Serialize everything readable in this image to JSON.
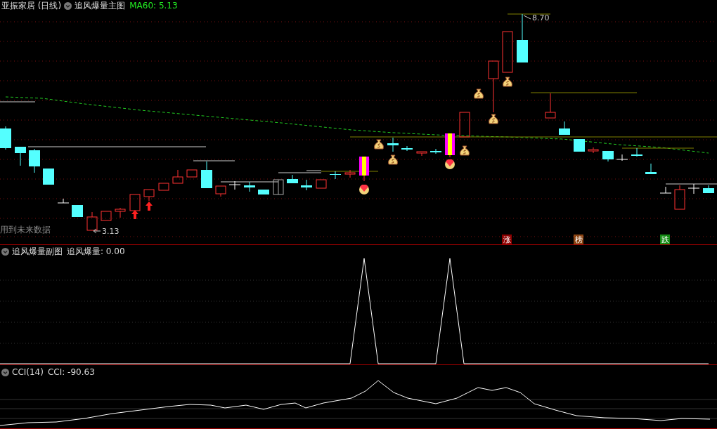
{
  "main_panel": {
    "stock_title": "亚振家居 (日线)",
    "indicator_name": "追风爆量主图",
    "ma_label": "MA60: 5.13",
    "high_label": "8.70",
    "low_label": "3.13",
    "warning": "用到未来数据",
    "badges": [
      {
        "text": "涨",
        "color": "#8b0000"
      },
      {
        "text": "榜",
        "color": "#8b4513"
      },
      {
        "text": "跌",
        "color": "#138a13"
      }
    ]
  },
  "sub_panel": {
    "indicator_name": "追风爆量副图",
    "value_label": "追风爆量: 0.00"
  },
  "cci_panel": {
    "indicator_name": "CCI(14)",
    "value_label": "CCI: -90.63"
  }
}
